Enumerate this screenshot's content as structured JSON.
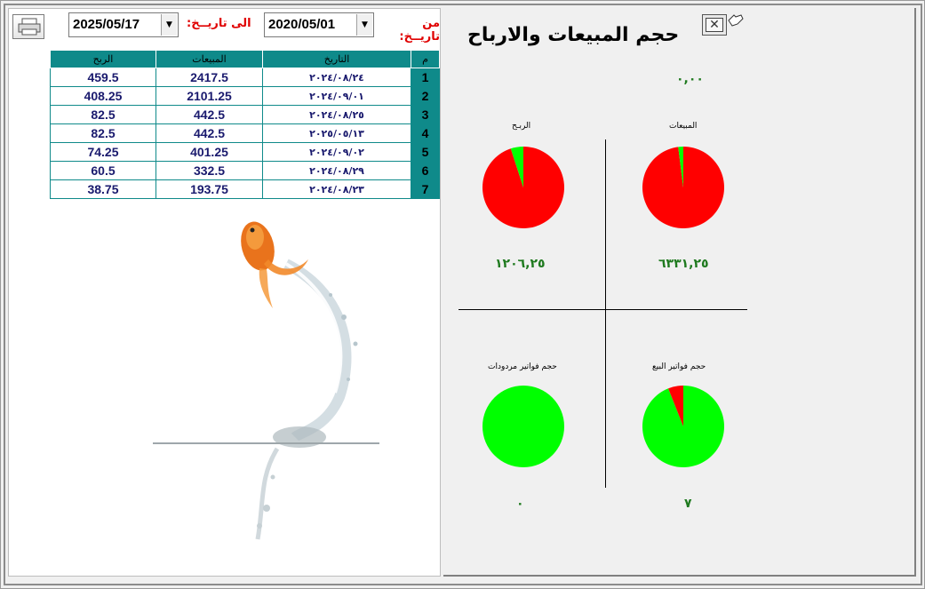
{
  "header": {
    "title": "حجم المبيعات والارباح",
    "from_label": "من تاريــخ:",
    "to_label": "الى تاريــخ:",
    "from_date": "2020/05/01",
    "to_date": "2025/05/17",
    "dropdown_glyph": "▼",
    "close_glyph": "✕"
  },
  "table": {
    "columns": [
      "م",
      "التاريخ",
      "المبيعات",
      "الربح"
    ],
    "rows": [
      {
        "idx": "1",
        "date": "٢٠٢٤/٠٨/٢٤",
        "sales": "2417.5",
        "profit": "459.5"
      },
      {
        "idx": "2",
        "date": "٢٠٢٤/٠٩/٠١",
        "sales": "2101.25",
        "profit": "408.25"
      },
      {
        "idx": "3",
        "date": "٢٠٢٤/٠٨/٢٥",
        "sales": "442.5",
        "profit": "82.5"
      },
      {
        "idx": "4",
        "date": "٢٠٢٥/٠٥/١٣",
        "sales": "442.5",
        "profit": "82.5"
      },
      {
        "idx": "5",
        "date": "٢٠٢٤/٠٩/٠٢",
        "sales": "401.25",
        "profit": "74.25"
      },
      {
        "idx": "6",
        "date": "٢٠٢٤/٠٨/٢٩",
        "sales": "332.5",
        "profit": "60.5"
      },
      {
        "idx": "7",
        "date": "٢٠٢٤/٠٨/٢٣",
        "sales": "193.75",
        "profit": "38.75"
      }
    ]
  },
  "stats": {
    "top_value": "٠,٠٠",
    "sales_label": "المبيعات",
    "profit_label": "الربـح",
    "sales_total": "٦٣٣١,٢٥",
    "profit_total": "١٢٠٦,٢٥",
    "sales_invoices_label": "حجم فواتير البيع",
    "returns_invoices_label": "حجم فواتير مردودات",
    "sales_invoices_count": "٧",
    "returns_invoices_count": "٠"
  },
  "chart_data": [
    {
      "type": "pie",
      "name": "المبيعات",
      "slices": [
        {
          "label": "red",
          "value": 0.98
        },
        {
          "label": "green",
          "value": 0.02
        }
      ],
      "colors": [
        "#ff0000",
        "#00ff00"
      ]
    },
    {
      "type": "pie",
      "name": "الربـح",
      "slices": [
        {
          "label": "red",
          "value": 0.95
        },
        {
          "label": "green",
          "value": 0.05
        }
      ],
      "colors": [
        "#ff0000",
        "#00ff00"
      ]
    },
    {
      "type": "pie",
      "name": "حجم فواتير البيع",
      "slices": [
        {
          "label": "green",
          "value": 0.94
        },
        {
          "label": "red",
          "value": 0.06
        }
      ],
      "colors": [
        "#00ff00",
        "#ff0000"
      ]
    },
    {
      "type": "pie",
      "name": "حجم فواتير مردودات",
      "slices": [
        {
          "label": "green",
          "value": 1.0
        }
      ],
      "colors": [
        "#00ff00"
      ]
    }
  ],
  "colors": {
    "header_teal": "#0f8a8a",
    "label_red": "#e00000",
    "value_green": "#1f7a1f",
    "pie_red": "#ff0000",
    "pie_green": "#00ff00"
  }
}
